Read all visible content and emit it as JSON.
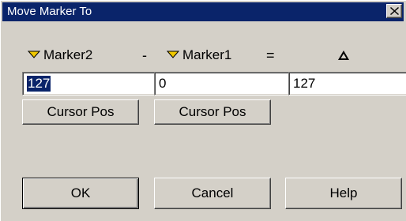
{
  "window": {
    "title": "Move Marker To",
    "close_glyph": "X"
  },
  "headers": {
    "left_marker": "Marker2",
    "minus": "-",
    "right_marker": "Marker1",
    "equals": "=",
    "delta": "Δ",
    "marker_icon": "triangle-down-icon",
    "marker_icon_color": "#f0c800"
  },
  "fields": {
    "marker2_value": "127",
    "marker1_value": "0",
    "delta_value": "127"
  },
  "buttons": {
    "cursor_pos_left": "Cursor Pos",
    "cursor_pos_right": "Cursor Pos",
    "ok": "OK",
    "cancel": "Cancel",
    "help": "Help"
  }
}
